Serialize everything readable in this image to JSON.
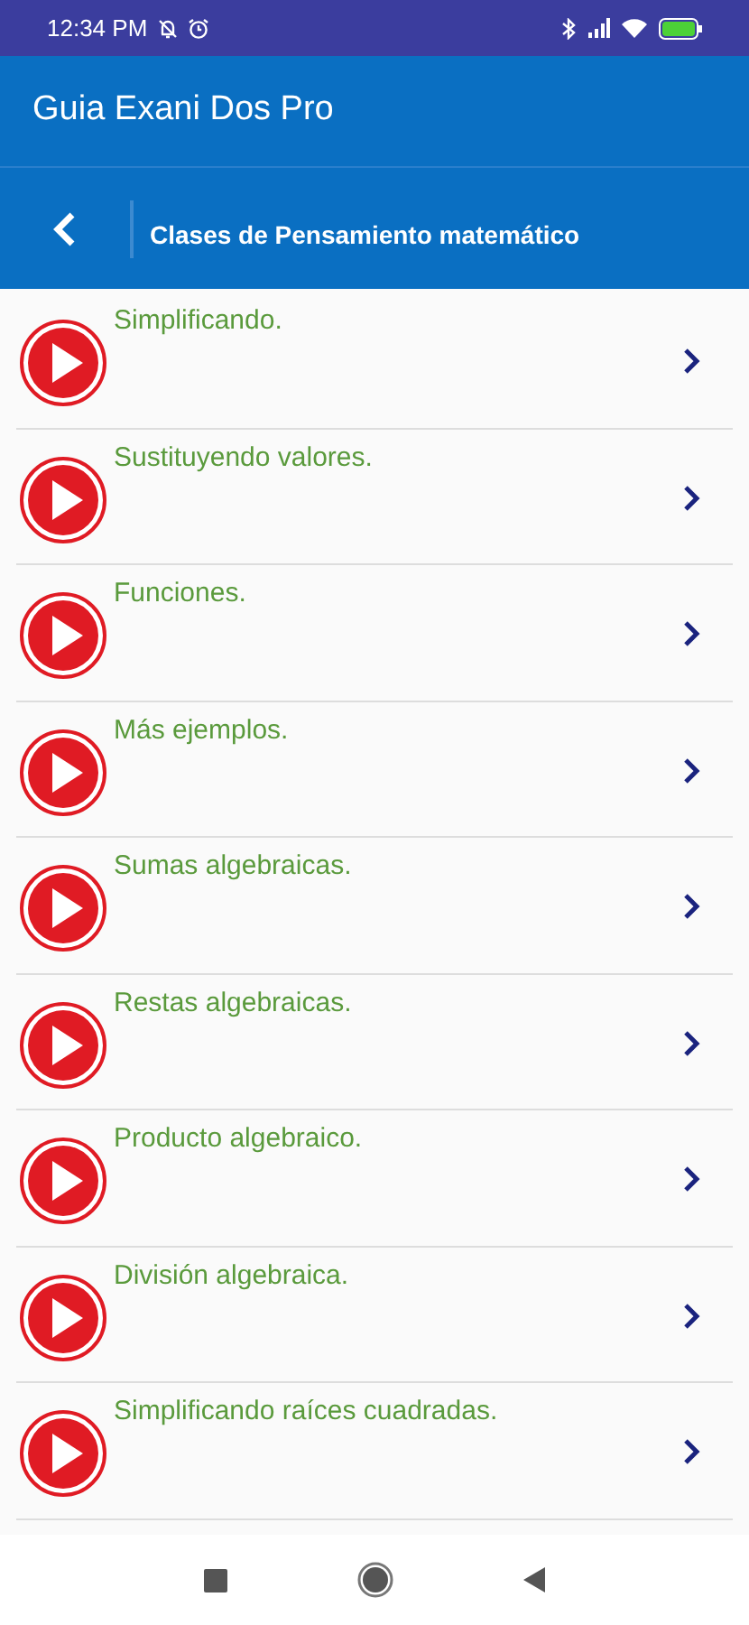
{
  "status_bar": {
    "time": "12:34 PM"
  },
  "app_bar": {
    "title": "Guia Exani Dos Pro"
  },
  "section_header": {
    "title": "Clases de Pensamiento matemático"
  },
  "lessons": [
    {
      "title": "Simplificando."
    },
    {
      "title": "Sustituyendo valores."
    },
    {
      "title": "Funciones."
    },
    {
      "title": "Más ejemplos."
    },
    {
      "title": "Sumas algebraicas."
    },
    {
      "title": "Restas algebraicas."
    },
    {
      "title": "Producto algebraico."
    },
    {
      "title": "División algebraica."
    },
    {
      "title": "Simplificando raíces cuadradas."
    }
  ]
}
